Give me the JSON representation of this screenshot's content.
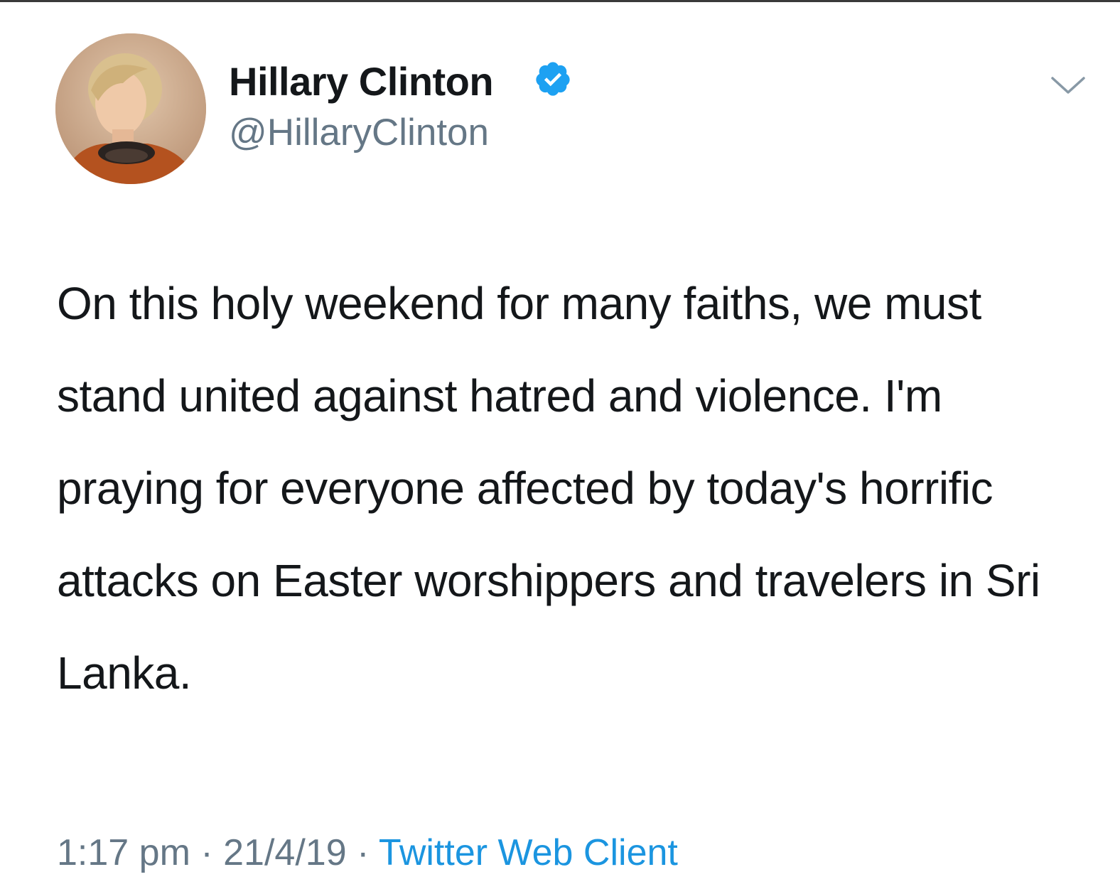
{
  "tweet": {
    "author": {
      "display_name": "Hillary Clinton",
      "handle": "@HillaryClinton",
      "verified": true
    },
    "text": "On this holy weekend for many faiths, we must stand united against hatred and violence. I'm praying for everyone affected by today's horrific attacks on Easter worshippers and travelers in Sri Lanka.",
    "time": "1:17 pm",
    "date": "21/4/19",
    "separator": "·",
    "source": "Twitter Web Client"
  },
  "icons": {
    "verified": "verified-badge-icon",
    "menu": "chevron-down-icon"
  },
  "colors": {
    "text_primary": "#14171a",
    "text_secondary": "#657786",
    "link": "#1b95e0",
    "verified": "#1da1f2"
  }
}
